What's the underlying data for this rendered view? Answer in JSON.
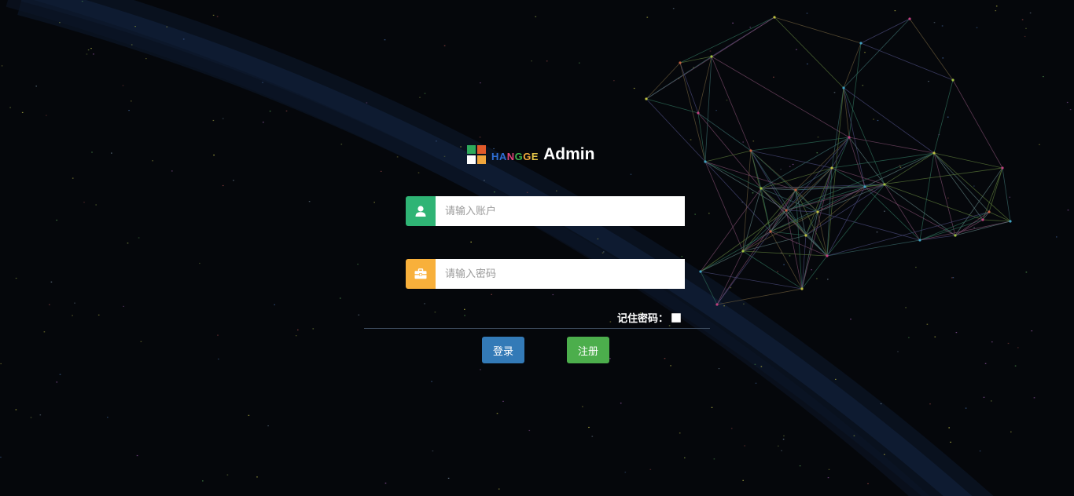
{
  "logo": {
    "brand": [
      "H",
      "A",
      "N",
      "G",
      "G",
      "E"
    ],
    "brand_colors": [
      "#2f6fd6",
      "#2f6fd6",
      "#e0457b",
      "#3bb24f",
      "#f2a93b",
      "#e4c548"
    ],
    "title": "Admin",
    "mark_colors": [
      "#2eaa5c",
      "#e05a2a",
      "#ffffff",
      "#f0a63c"
    ]
  },
  "login_form": {
    "account": {
      "placeholder": "请输入账户",
      "value": "",
      "icon": "user-icon",
      "icon_color": "#2fb475"
    },
    "password": {
      "placeholder": "请输入密码",
      "value": "",
      "icon": "briefcase-icon",
      "icon_color": "#f8b03b"
    },
    "remember_label": "记住密码：",
    "remember_checked": false,
    "login_label": "登录",
    "register_label": "注册"
  },
  "colors": {
    "login_button": "#337ab7",
    "register_button": "#4cae4c",
    "background": "#05070b"
  }
}
